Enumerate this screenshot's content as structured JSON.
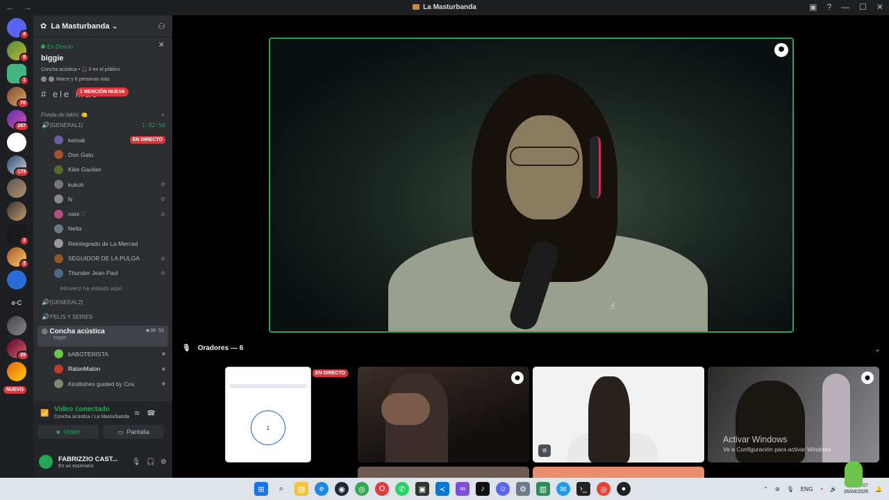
{
  "window": {
    "title": "La Masturbanda"
  },
  "rail": {
    "badges": [
      "4",
      "6",
      "1",
      "70",
      "267",
      "173",
      "3",
      "2",
      "29"
    ],
    "eg_label": "e-C",
    "nuevo": "NUEVO"
  },
  "server": {
    "name": "La Masturbanda"
  },
  "live_panel": {
    "status": "En Directo",
    "streamer": "biggie",
    "detail": "Concha acústica • 🎧 0 en el público",
    "viewers": "Marce y 6 personas más"
  },
  "channel_header": {
    "name": "# ele      mas",
    "mention": "1 MENCIÓN NUEVA"
  },
  "category": {
    "name": "Fonda de bikini 🍋"
  },
  "voice_general1": {
    "name": "[GENERAL1]",
    "timer": "1:02:50"
  },
  "general1_users": [
    {
      "name": "keinak",
      "tag": "EN DIRECTO"
    },
    {
      "name": "Don Gato"
    },
    {
      "name": "Kike Gavilan"
    },
    {
      "name": "kukoh"
    },
    {
      "name": "N"
    },
    {
      "name": "nani ♡"
    },
    {
      "name": "Nella"
    },
    {
      "name": "Reintegrado de La Merced"
    },
    {
      "name": "SEGUIDOR DE LA PULGA"
    },
    {
      "name": "Thunder Jean Paul"
    }
  ],
  "previous_user": {
    "name": "inkxverz",
    "suffix": "ha estado aquí"
  },
  "voice_general2": {
    "name": "[GENERAL2]"
  },
  "voice_pelis": {
    "name": "PELIS Y SERIES"
  },
  "stage_channel": {
    "name": "Concha acústica",
    "sub": "biggie",
    "count1": "06",
    "count2": "50"
  },
  "stage_users": [
    {
      "name": "bABOTERISTA"
    },
    {
      "name": "RatonMaton"
    },
    {
      "name": "Kindlishes guided by Cos"
    }
  ],
  "connection": {
    "status": "Vídeo conectado",
    "location": "Concha acústica / La Masturbanda",
    "video_label": "Vídeo",
    "screen_label": "Pantalla"
  },
  "user_panel": {
    "name": "FABRIZZIO CAST...",
    "status": "En un escenario"
  },
  "speakers": {
    "label": "Oradores — 6"
  },
  "tiles": {
    "live_tag": "EN DIRECTO",
    "circle_value": "1"
  },
  "watermark": {
    "line1": "Activar Windows",
    "line2": "Ve a Configuración para activar Windows"
  },
  "tray": {
    "lang": "ENG",
    "time": "1:07",
    "date": "26/04/2026"
  }
}
